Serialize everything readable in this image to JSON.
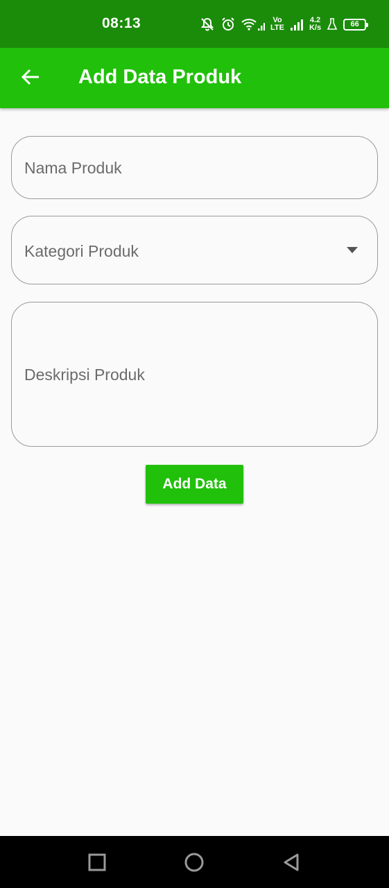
{
  "status_bar": {
    "time": "08:13",
    "network_line1": "Vo",
    "network_line2": "LTE",
    "speed_value": "4.2",
    "speed_unit": "K/s",
    "battery": "66",
    "icons": [
      "mute-bell-icon",
      "alarm-icon",
      "wifi-icon",
      "signal-icon",
      "volte-icon",
      "signal-icon",
      "lab-flask-icon",
      "battery-icon"
    ]
  },
  "app_bar": {
    "title": "Add Data Produk",
    "back_icon": "arrow-left-icon"
  },
  "form": {
    "name_placeholder": "Nama Produk",
    "category_placeholder": "Kategori Produk",
    "description_placeholder": "Deskripsi Produk",
    "submit_label": "Add Data"
  },
  "nav_bar": {
    "icons": [
      "recents-square-icon",
      "home-circle-icon",
      "back-triangle-icon"
    ]
  },
  "colors": {
    "status_bar": "#1b8c0a",
    "app_bar": "#21c00b",
    "button": "#21c00b",
    "background": "#fafafa"
  }
}
